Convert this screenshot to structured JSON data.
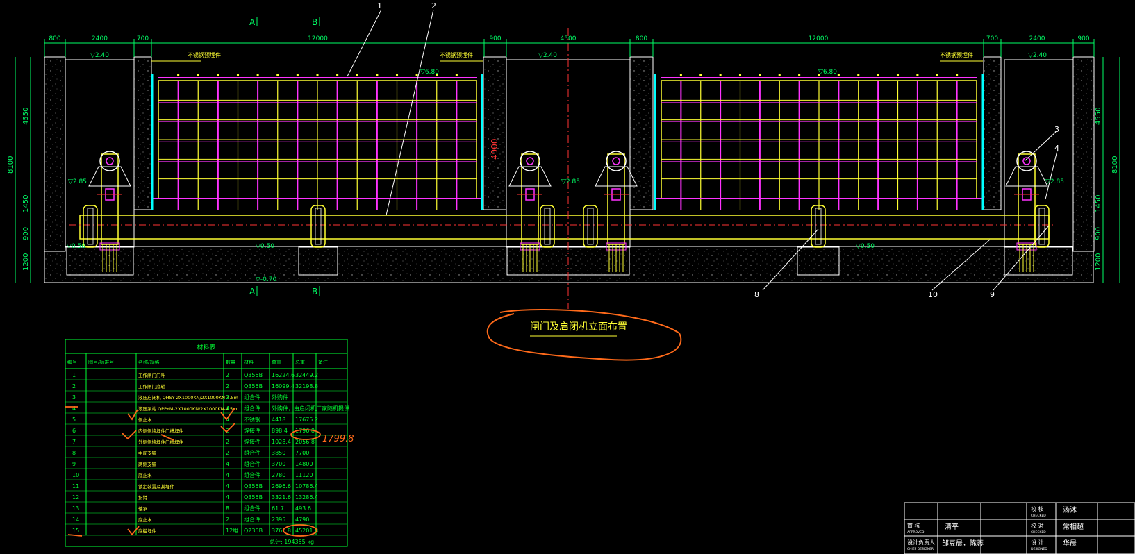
{
  "colors": {
    "background": "#000000",
    "dimension": "#00ff66",
    "wall": "#ffffff",
    "gate_frame": "#ffff33",
    "gate_rib": "#ff33ff",
    "seal": "#00ffff",
    "axis": "#ff3333",
    "table": "#00ff33",
    "annotation": "#ff6a1a"
  },
  "top_dimensions": [
    "800",
    "2400",
    "700",
    "12000",
    "900",
    "4500",
    "800",
    "12000",
    "700",
    "2400",
    "900"
  ],
  "left_dimensions": {
    "total": "8100",
    "parts": [
      "4550",
      "1450",
      "900",
      "1200"
    ]
  },
  "right_dimensions": {
    "total": "8100",
    "parts": [
      "4550",
      "1450",
      "900",
      "1200"
    ]
  },
  "elevations": {
    "top_left": "▽2.40",
    "top_mid": "▽2.40",
    "top_right": "▽2.40",
    "gate_top_left": "▽6.80",
    "gate_top_right": "▽6.80",
    "mid_left": "▽2.85",
    "mid_center": "▽2.85",
    "mid_right": "▽2.85",
    "bottom_left": "▽0.50",
    "bottom_mid": "▽0.50",
    "bottom_right": "▽0.50",
    "base": "▽-0.70"
  },
  "section_marks": {
    "a_top": "A",
    "b_top": "B",
    "a_bottom": "A",
    "b_bottom": "B"
  },
  "embedded_part_labels": [
    "不锈钢预埋件",
    "不锈钢预埋件",
    "不锈钢预埋件"
  ],
  "vertical_dim": "4900",
  "callouts": [
    "1",
    "2",
    "3",
    "4",
    "8",
    "10",
    "9"
  ],
  "drawing_title": "闸门及启闭机立面布置",
  "bom": {
    "title": "材料表",
    "headers": [
      "编号",
      "图号/标准号",
      "名称/规格",
      "数量",
      "材料",
      "单重",
      "总重",
      "备注"
    ],
    "rows": [
      [
        "1",
        "",
        "工作闸门门叶",
        "2",
        "Q355B",
        "16224.6",
        "32449.2",
        ""
      ],
      [
        "2",
        "",
        "工作闸门底轴",
        "2",
        "Q355B",
        "16099.4",
        "32198.8",
        ""
      ],
      [
        "3",
        "",
        "液压启闭机 QHSY-2X1000KN/2X1000KN-4.5m",
        "2",
        "组合件",
        "外购件",
        "",
        ""
      ],
      [
        "4",
        "",
        "液压泵站 QPPYM-2X1000KN/2X1000KN-4.5m",
        "4",
        "组合件",
        "外购件，由启闭机厂家随机提供",
        "",
        ""
      ],
      [
        "5",
        "",
        "侧止水",
        "4",
        "不锈钢",
        "4418",
        "17675.2",
        ""
      ],
      [
        "6",
        "",
        "内侧侧墙埋件门槽埋件",
        "2",
        "焊接件",
        "898.4",
        "1796.8",
        ""
      ],
      [
        "7",
        "",
        "外侧侧墙埋件门槽埋件",
        "2",
        "焊接件",
        "1028.4",
        "2056.8",
        ""
      ],
      [
        "8",
        "",
        "中间支铰",
        "2",
        "组合件",
        "3850",
        "7700",
        ""
      ],
      [
        "9",
        "",
        "两侧支铰",
        "4",
        "组合件",
        "3700",
        "14800",
        ""
      ],
      [
        "10",
        "",
        "底止水",
        "4",
        "组合件",
        "2780",
        "11120",
        ""
      ],
      [
        "11",
        "",
        "锁定装置及其埋件",
        "4",
        "Q355B",
        "2696.6",
        "10786.4",
        ""
      ],
      [
        "12",
        "",
        "拐臂",
        "4",
        "Q355B",
        "3321.6",
        "13286.4",
        ""
      ],
      [
        "13",
        "",
        "轴承",
        "8",
        "组合件",
        "61.7",
        "493.6",
        ""
      ],
      [
        "14",
        "",
        "底止水",
        "2",
        "组合件",
        "2395",
        "4790",
        ""
      ],
      [
        "15",
        "",
        "底槛埋件",
        "12组",
        "Q235B",
        "3766.8",
        "45201.8",
        ""
      ]
    ],
    "total": "总计: 194355 kg"
  },
  "handwritten": {
    "note": "1799.8"
  },
  "title_block": {
    "labels": [
      "审 核",
      "设计负责人",
      "校 核",
      "校 对",
      "设 计"
    ],
    "sub_labels": [
      "APPROVED",
      "CHIEF DESIGNER",
      "CHECKED",
      "CHECKED",
      "DESIGNED"
    ],
    "names": [
      "清平",
      "邹豆晨，陈蓉",
      "汤沐",
      "常相超",
      "华晨"
    ]
  }
}
